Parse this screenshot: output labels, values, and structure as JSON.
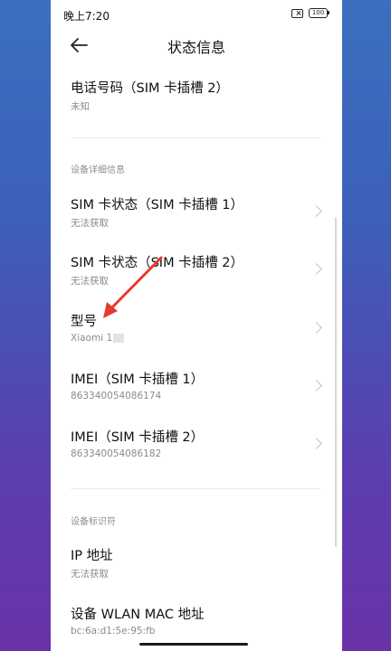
{
  "status_bar": {
    "time": "晚上7:20",
    "battery": "100"
  },
  "header": {
    "title": "状态信息"
  },
  "rows_top": [
    {
      "title": "电话号码（SIM 卡插槽 2）",
      "subtitle": "未知"
    }
  ],
  "section_device": {
    "label": "设备详细信息",
    "rows": [
      {
        "title": "SIM 卡状态（SIM 卡插槽 1）",
        "subtitle": "无法获取"
      },
      {
        "title": "SIM 卡状态（SIM 卡插槽 2）",
        "subtitle": "无法获取"
      },
      {
        "title": "型号",
        "subtitle": "Xiaomi 1"
      },
      {
        "title": "IMEI（SIM 卡插槽 1）",
        "subtitle": "863340054086174"
      },
      {
        "title": "IMEI（SIM 卡插槽 2）",
        "subtitle": "863340054086182"
      }
    ]
  },
  "section_ids": {
    "label": "设备标识符",
    "rows": [
      {
        "title": "IP 地址",
        "subtitle": "无法获取"
      },
      {
        "title": "设备 WLAN MAC 地址",
        "subtitle": "bc:6a:d1:5e:95:fb"
      }
    ]
  },
  "colors": {
    "accent_arrow": "#e8392e",
    "background_top": "#3b6fc0",
    "background_bottom": "#6a32a8"
  },
  "icons": [
    "back-arrow-icon",
    "chevron-right-icon",
    "sim-error-icon",
    "battery-icon"
  ]
}
